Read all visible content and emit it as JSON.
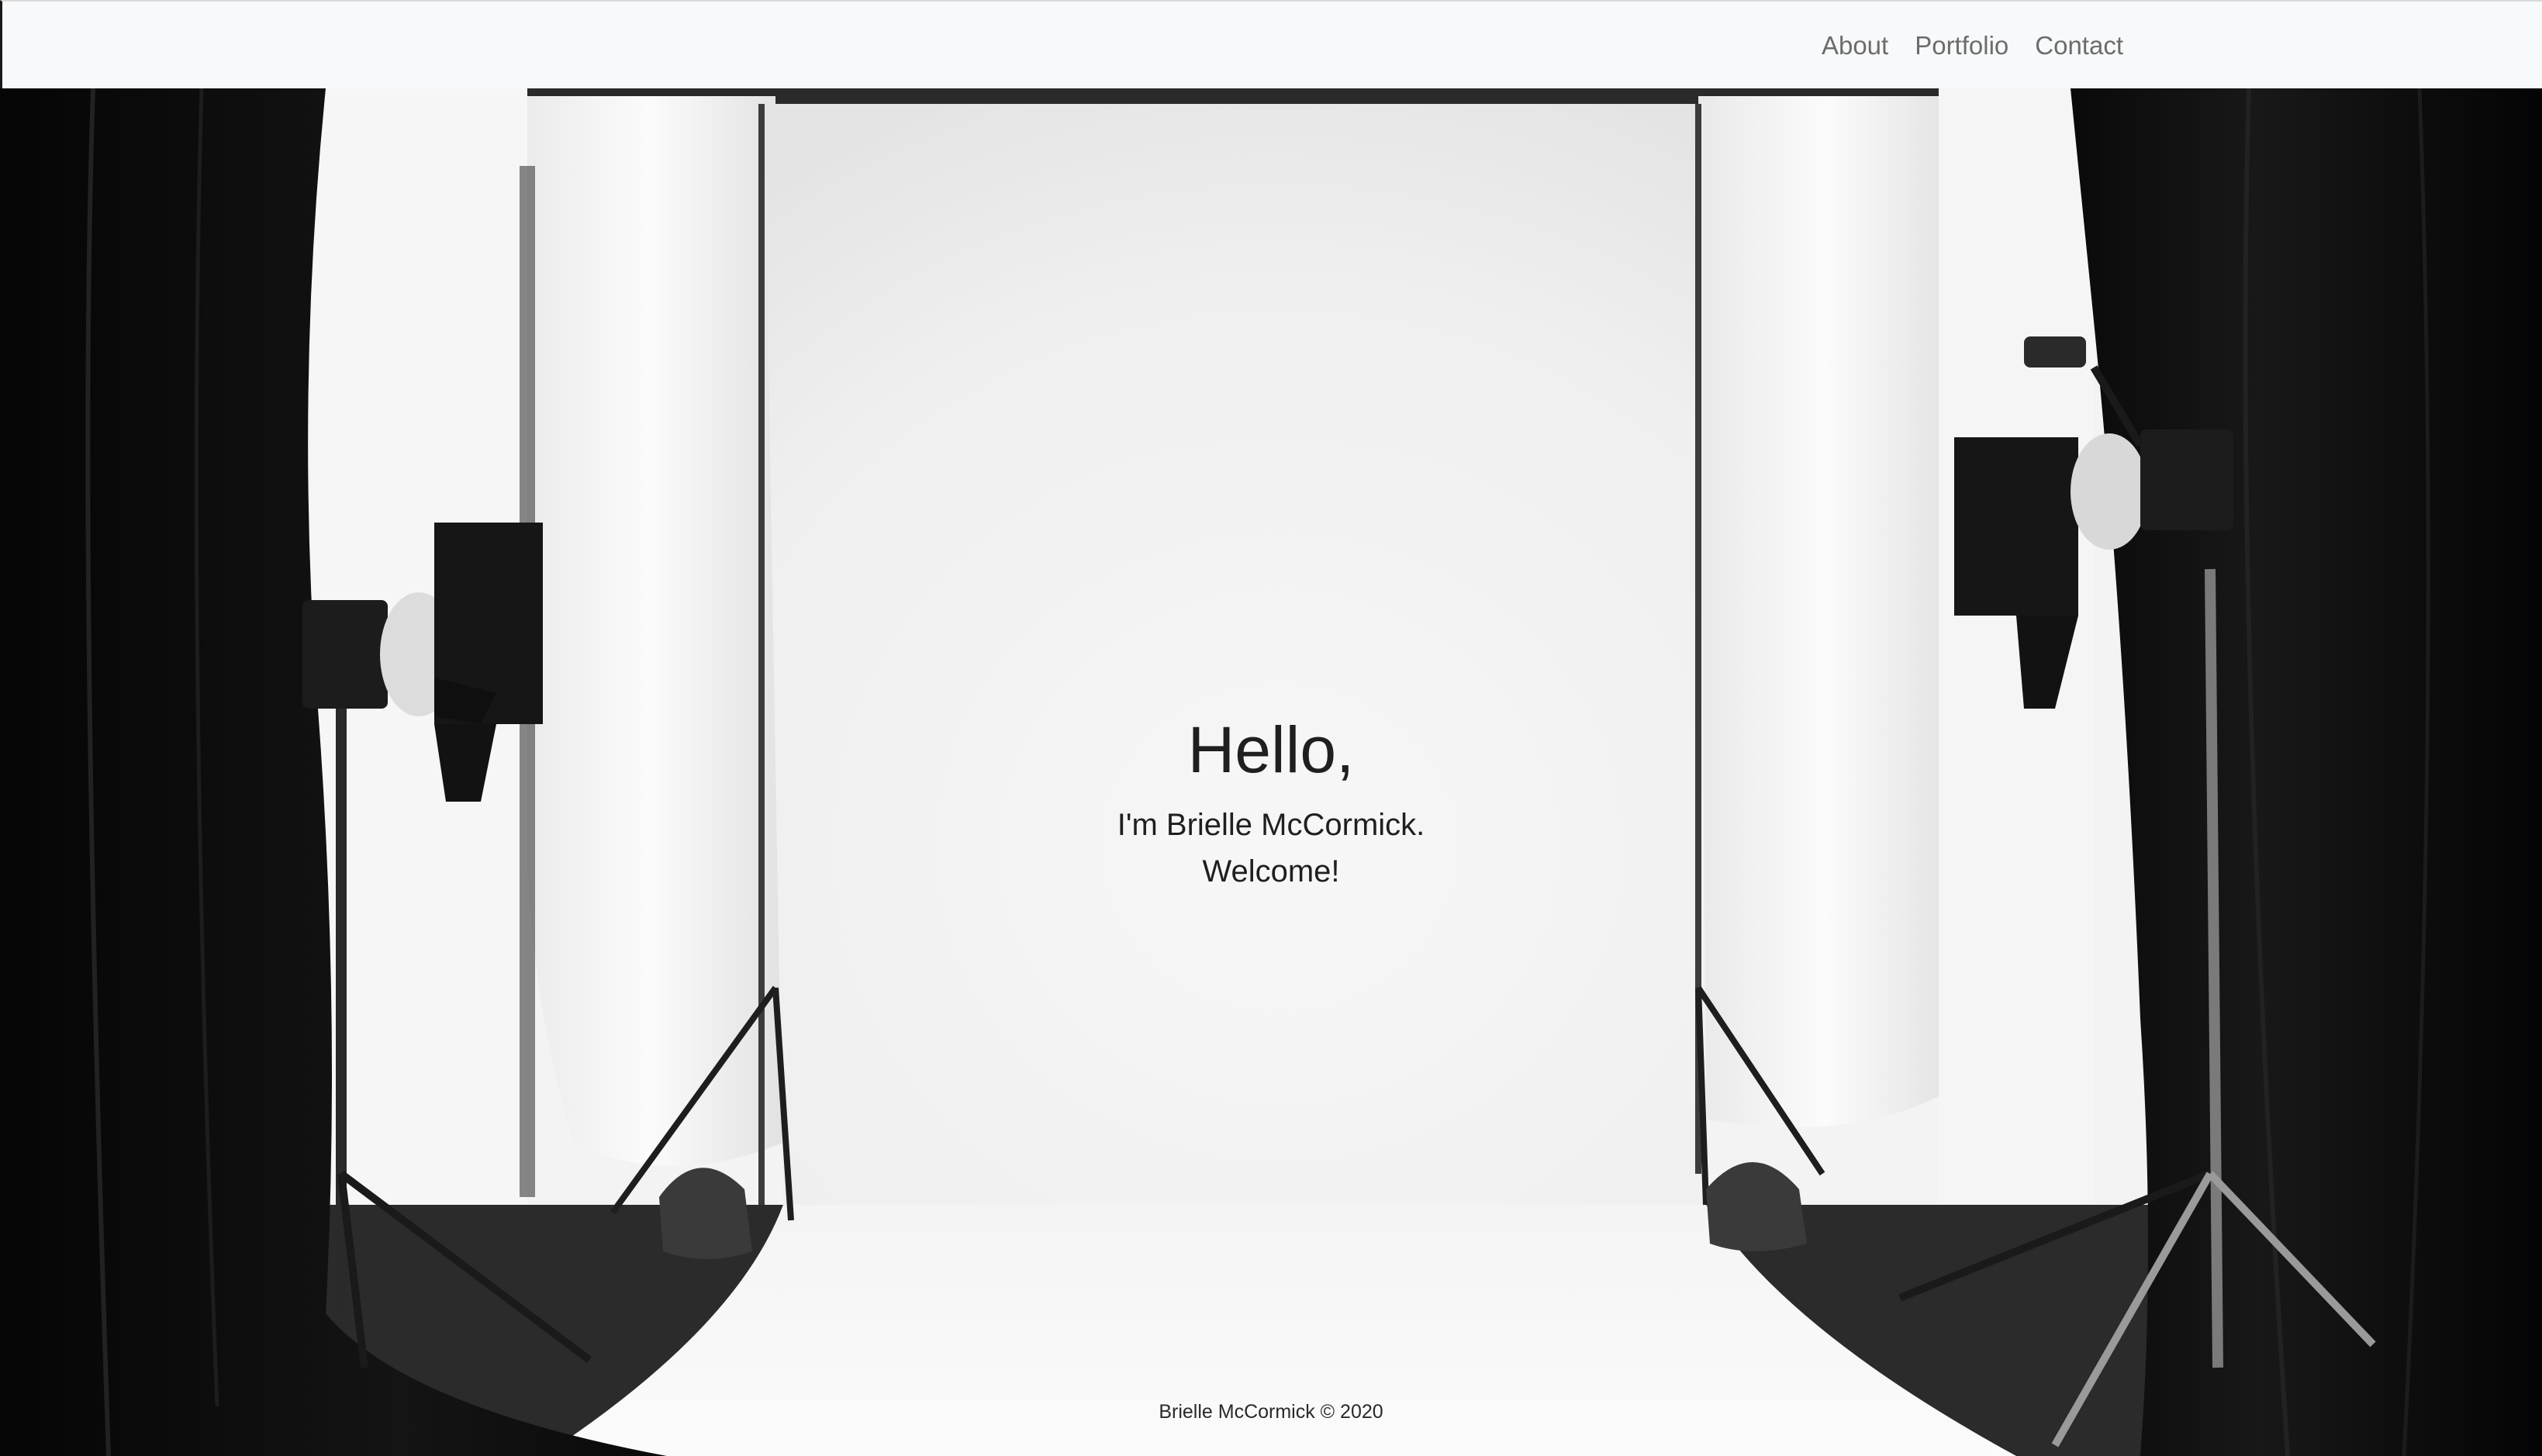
{
  "nav": {
    "links": [
      {
        "label": "About"
      },
      {
        "label": "Portfolio"
      },
      {
        "label": "Contact"
      }
    ]
  },
  "hero": {
    "greeting": "Hello,",
    "intro_line1": "I'm Brielle McCormick.",
    "intro_line2": "Welcome!",
    "background": "black-and-white photo studio with white backdrop, black curtains and studio lights"
  },
  "footer": {
    "text": "Brielle McCormick © 2020"
  },
  "colors": {
    "navbar_bg": "#f8f9fa",
    "nav_link": "#6c6c6c",
    "hero_text": "#1f1f1f"
  }
}
